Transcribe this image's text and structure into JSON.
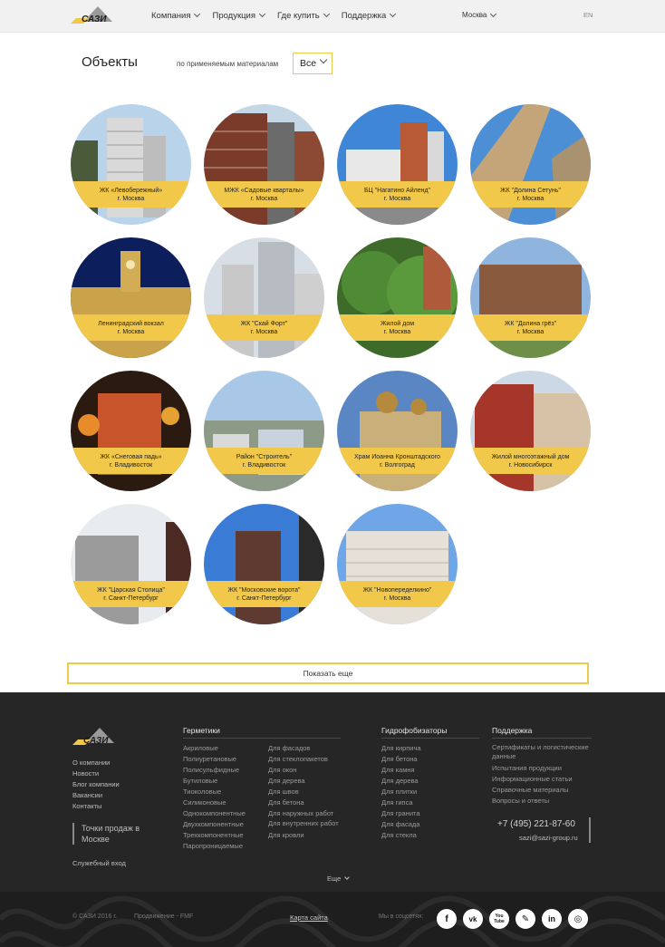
{
  "header": {
    "nav": [
      {
        "label": "Компания"
      },
      {
        "label": "Продукция"
      },
      {
        "label": "Где купить"
      },
      {
        "label": "Поддержка"
      }
    ],
    "city": "Москва",
    "lang": "EN"
  },
  "page": {
    "title": "Объекты",
    "filter_label": "по применяемым материалам",
    "filter_value": "Все"
  },
  "objects": [
    {
      "name": "ЖК «Левобережный»",
      "city": "г. Москва"
    },
    {
      "name": "МЖК «Садовые кварталы»",
      "city": "г. Москва"
    },
    {
      "name": "БЦ \"Нагатино Айленд\"",
      "city": "г. Москва"
    },
    {
      "name": "ЖК \"Долина Сетунь\"",
      "city": "г. Москва"
    },
    {
      "name": "Ленинградский вокзал",
      "city": "г. Москва"
    },
    {
      "name": "ЖК \"Скай Форт\"",
      "city": "г. Москва"
    },
    {
      "name": "Жилой дом",
      "city": "г. Москва"
    },
    {
      "name": "ЖК \"Долина грёз\"",
      "city": "г. Москва"
    },
    {
      "name": "ЖК «Снеговая падь»",
      "city": "г. Владивосток"
    },
    {
      "name": "Район \"Строитель\"",
      "city": "г. Владивосток"
    },
    {
      "name": "Храм Иоанна Кронштадского",
      "city": "г. Волгоград"
    },
    {
      "name": "Жилой многоэтажный дом",
      "city": "г. Новосибирск"
    },
    {
      "name": "ЖК \"Царская Столица\"",
      "city": "г. Санкт-Петербург"
    },
    {
      "name": "ЖК \"Московские ворота\"",
      "city": "г. Санкт-Петербург"
    },
    {
      "name": "ЖК \"Новопеределкино\"",
      "city": "г. Москва"
    }
  ],
  "show_more": "Показать еще",
  "footer": {
    "links": [
      "О компании",
      "Новости",
      "Блог компании",
      "Вакансии",
      "Контакты"
    ],
    "points_of_sale": "Точки продаж в Москве",
    "service_login": "Служебный вход",
    "sealants": {
      "title": "Герметики",
      "col1": [
        "Акриловые",
        "Полиуретановые",
        "Полисульфидные",
        "Бутиловые",
        "Тиоколовые",
        "Силиконовые",
        "Однокомпонентные",
        "Двухкомпонентные",
        "Трехкомпонентные",
        "Паропроницаемые"
      ],
      "col2": [
        "Для фасадов",
        "Для стеклопакетов",
        "Для окон",
        "Для дерева",
        "Для швов",
        "Для бетона",
        "Для наружных работ",
        "Для внутренних работ",
        "Для кровли"
      ]
    },
    "hydrophobizers": {
      "title": "Гидрофобизаторы",
      "items": [
        "Для кирпича",
        "Для бетона",
        "Для камня",
        "Для дерева",
        "Для плитки",
        "Для гипса",
        "Для гранита",
        "Для фасада",
        "Для стекла"
      ]
    },
    "support": {
      "title": "Поддержка",
      "items": [
        "Сертификаты и логистические данные",
        "Испытания продукции",
        "Информационные статьи",
        "Справочные материалы",
        "Вопросы и ответы"
      ]
    },
    "phone": "+7 (495) 221-87-60",
    "email": "sazi@sazi-group.ru",
    "more": "Еще"
  },
  "bottom": {
    "copyright": "© САЗИ 2016 г.",
    "promo": "Продвижение - FMF",
    "sitemap": "Карта сайта",
    "social_label": "Мы в соцсетях:",
    "socials": [
      {
        "icon": "facebook-icon",
        "glyph": "f"
      },
      {
        "icon": "vk-icon",
        "glyph": "vk"
      },
      {
        "icon": "youtube-icon",
        "glyph": "You Tube"
      },
      {
        "icon": "livejournal-icon",
        "glyph": "✎"
      },
      {
        "icon": "linkedin-icon",
        "glyph": "in"
      },
      {
        "icon": "instagram-icon",
        "glyph": "◎"
      }
    ]
  },
  "colors": {
    "accent": "#f2c84b",
    "footer_bg": "#262626",
    "bottom_bg": "#1e1e1e"
  }
}
